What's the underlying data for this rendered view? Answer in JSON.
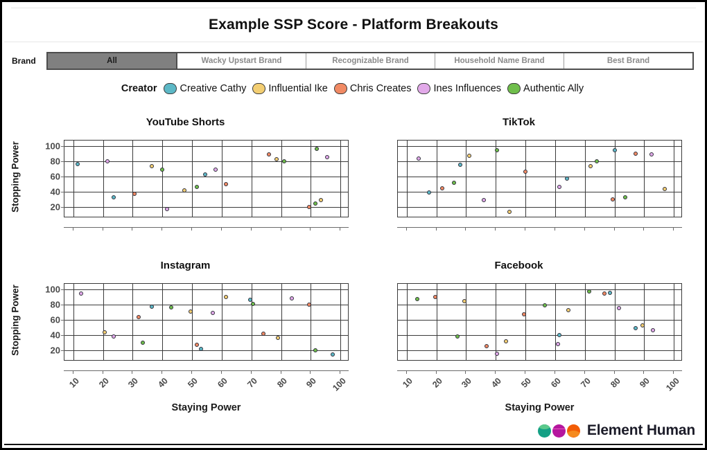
{
  "header": {
    "title": "Example SSP Score - Platform Breakouts"
  },
  "brand": {
    "label": "Brand",
    "tabs": [
      {
        "label": "All",
        "active": true
      },
      {
        "label": "Wacky Upstart Brand",
        "active": false
      },
      {
        "label": "Recognizable Brand",
        "active": false
      },
      {
        "label": "Household Name Brand",
        "active": false
      },
      {
        "label": "Best Brand",
        "active": false
      }
    ]
  },
  "legend": {
    "title": "Creator",
    "items": [
      {
        "label": "Creative Cathy",
        "color": "#5CB8C6"
      },
      {
        "label": "Influential Ike",
        "color": "#F3CE72"
      },
      {
        "label": "Chris Creates",
        "color": "#F18A64"
      },
      {
        "label": "Ines Influences",
        "color": "#E2A9E9"
      },
      {
        "label": "Authentic Ally",
        "color": "#6FBE4B"
      }
    ]
  },
  "footer": {
    "logo_text": "Element Human",
    "logo_colors": [
      "#14A085",
      "#B5179E",
      "#F25C05"
    ],
    "logo_band_colors": [
      "#5BC98C",
      "#E85DBE",
      "#F58A1F"
    ]
  },
  "chart_data": [
    {
      "type": "scatter",
      "title": "YouTube Shorts",
      "xlabel": "Staying Power",
      "ylabel": "Stopping Power",
      "xlim": [
        7,
        103
      ],
      "ylim": [
        5,
        107
      ],
      "xticks": [
        10,
        20,
        30,
        40,
        50,
        60,
        70,
        80,
        90,
        100
      ],
      "yticks": [
        20,
        40,
        60,
        80,
        100
      ],
      "grid": true,
      "series": [
        {
          "name": "Creative Cathy",
          "color": "#5CB8C6",
          "points": [
            [
              11.5,
              76
            ],
            [
              23.5,
              32
            ],
            [
              54.5,
              62
            ]
          ]
        },
        {
          "name": "Influential Ike",
          "color": "#F3CE72",
          "points": [
            [
              36.5,
              73
            ],
            [
              47.5,
              41
            ],
            [
              78.5,
              82
            ],
            [
              93.5,
              29
            ]
          ]
        },
        {
          "name": "Chris Creates",
          "color": "#F18A64",
          "points": [
            [
              30.5,
              37
            ],
            [
              61.5,
              50
            ],
            [
              76.0,
              89
            ],
            [
              89.5,
              20
            ]
          ]
        },
        {
          "name": "Ines Influences",
          "color": "#E2A9E9",
          "points": [
            [
              21.5,
              80
            ],
            [
              41.5,
              17
            ],
            [
              58.0,
              69
            ],
            [
              95.5,
              85
            ]
          ]
        },
        {
          "name": "Authentic Ally",
          "color": "#6FBE4B",
          "points": [
            [
              40.0,
              69
            ],
            [
              51.5,
              46
            ],
            [
              81.0,
              80
            ],
            [
              91.5,
              24
            ],
            [
              92.0,
              96
            ]
          ]
        }
      ]
    },
    {
      "type": "scatter",
      "title": "TikTok",
      "xlabel": "Staying Power",
      "ylabel": "",
      "xlim": [
        7,
        103
      ],
      "ylim": [
        5,
        107
      ],
      "xticks": [
        10,
        20,
        30,
        40,
        50,
        60,
        70,
        80,
        90,
        100
      ],
      "yticks": [
        20,
        40,
        60,
        80,
        100
      ],
      "grid": true,
      "series": [
        {
          "name": "Creative Cathy",
          "color": "#5CB8C6",
          "points": [
            [
              17.5,
              39
            ],
            [
              28.0,
              75
            ],
            [
              64.0,
              57
            ],
            [
              80.0,
              94
            ]
          ]
        },
        {
          "name": "Influential Ike",
          "color": "#F3CE72",
          "points": [
            [
              31.0,
              87
            ],
            [
              44.5,
              13
            ],
            [
              72.0,
              73
            ],
            [
              97.0,
              43
            ]
          ]
        },
        {
          "name": "Chris Creates",
          "color": "#F18A64",
          "points": [
            [
              22.0,
              44
            ],
            [
              50.0,
              66
            ],
            [
              79.5,
              30
            ],
            [
              87.0,
              90
            ]
          ]
        },
        {
          "name": "Ines Influences",
          "color": "#E2A9E9",
          "points": [
            [
              14.0,
              83
            ],
            [
              36.0,
              29
            ],
            [
              61.5,
              46
            ],
            [
              92.5,
              89
            ]
          ]
        },
        {
          "name": "Authentic Ally",
          "color": "#6FBE4B",
          "points": [
            [
              26.0,
              51
            ],
            [
              40.5,
              94
            ],
            [
              74.0,
              80
            ],
            [
              83.5,
              32
            ]
          ]
        }
      ]
    },
    {
      "type": "scatter",
      "title": "Instagram",
      "xlabel": "Staying Power",
      "ylabel": "Stopping Power",
      "xlim": [
        7,
        103
      ],
      "ylim": [
        5,
        107
      ],
      "xticks": [
        10,
        20,
        30,
        40,
        50,
        60,
        70,
        80,
        90,
        100
      ],
      "yticks": [
        20,
        40,
        60,
        80,
        100
      ],
      "grid": true,
      "series": [
        {
          "name": "Creative Cathy",
          "color": "#5CB8C6",
          "points": [
            [
              36.5,
              77
            ],
            [
              53.0,
              21
            ],
            [
              69.5,
              86
            ],
            [
              97.5,
              14
            ]
          ]
        },
        {
          "name": "Influential Ike",
          "color": "#F3CE72",
          "points": [
            [
              20.5,
              43
            ],
            [
              49.5,
              71
            ],
            [
              61.5,
              90
            ],
            [
              79.0,
              36
            ]
          ]
        },
        {
          "name": "Chris Creates",
          "color": "#F18A64",
          "points": [
            [
              32.0,
              63
            ],
            [
              51.5,
              27
            ],
            [
              74.0,
              41
            ],
            [
              89.5,
              80
            ]
          ]
        },
        {
          "name": "Ines Influences",
          "color": "#E2A9E9",
          "points": [
            [
              12.5,
              94
            ],
            [
              23.5,
              38
            ],
            [
              57.0,
              69
            ],
            [
              83.5,
              88
            ]
          ]
        },
        {
          "name": "Authentic Ally",
          "color": "#6FBE4B",
          "points": [
            [
              33.5,
              30
            ],
            [
              43.0,
              76
            ],
            [
              70.5,
              81
            ],
            [
              91.5,
              20
            ]
          ]
        }
      ]
    },
    {
      "type": "scatter",
      "title": "Facebook",
      "xlabel": "Staying Power",
      "ylabel": "",
      "xlim": [
        7,
        103
      ],
      "ylim": [
        5,
        107
      ],
      "xticks": [
        10,
        20,
        30,
        40,
        50,
        60,
        70,
        80,
        90,
        100
      ],
      "yticks": [
        20,
        40,
        60,
        80,
        100
      ],
      "grid": true,
      "series": [
        {
          "name": "Creative Cathy",
          "color": "#5CB8C6",
          "points": [
            [
              61.5,
              40
            ],
            [
              78.5,
              95
            ],
            [
              87.0,
              49
            ]
          ]
        },
        {
          "name": "Influential Ike",
          "color": "#F3CE72",
          "points": [
            [
              29.5,
              84
            ],
            [
              43.5,
              31
            ],
            [
              64.5,
              72
            ],
            [
              89.5,
              52
            ]
          ]
        },
        {
          "name": "Chris Creates",
          "color": "#F18A64",
          "points": [
            [
              19.5,
              90
            ],
            [
              37.0,
              25
            ],
            [
              49.5,
              67
            ],
            [
              76.5,
              94
            ]
          ]
        },
        {
          "name": "Ines Influences",
          "color": "#E2A9E9",
          "points": [
            [
              40.5,
              15
            ],
            [
              61.0,
              28
            ],
            [
              81.5,
              75
            ],
            [
              93.0,
              46
            ]
          ]
        },
        {
          "name": "Authentic Ally",
          "color": "#6FBE4B",
          "points": [
            [
              13.5,
              87
            ],
            [
              27.0,
              38
            ],
            [
              56.5,
              79
            ],
            [
              71.5,
              97
            ]
          ]
        }
      ]
    }
  ]
}
